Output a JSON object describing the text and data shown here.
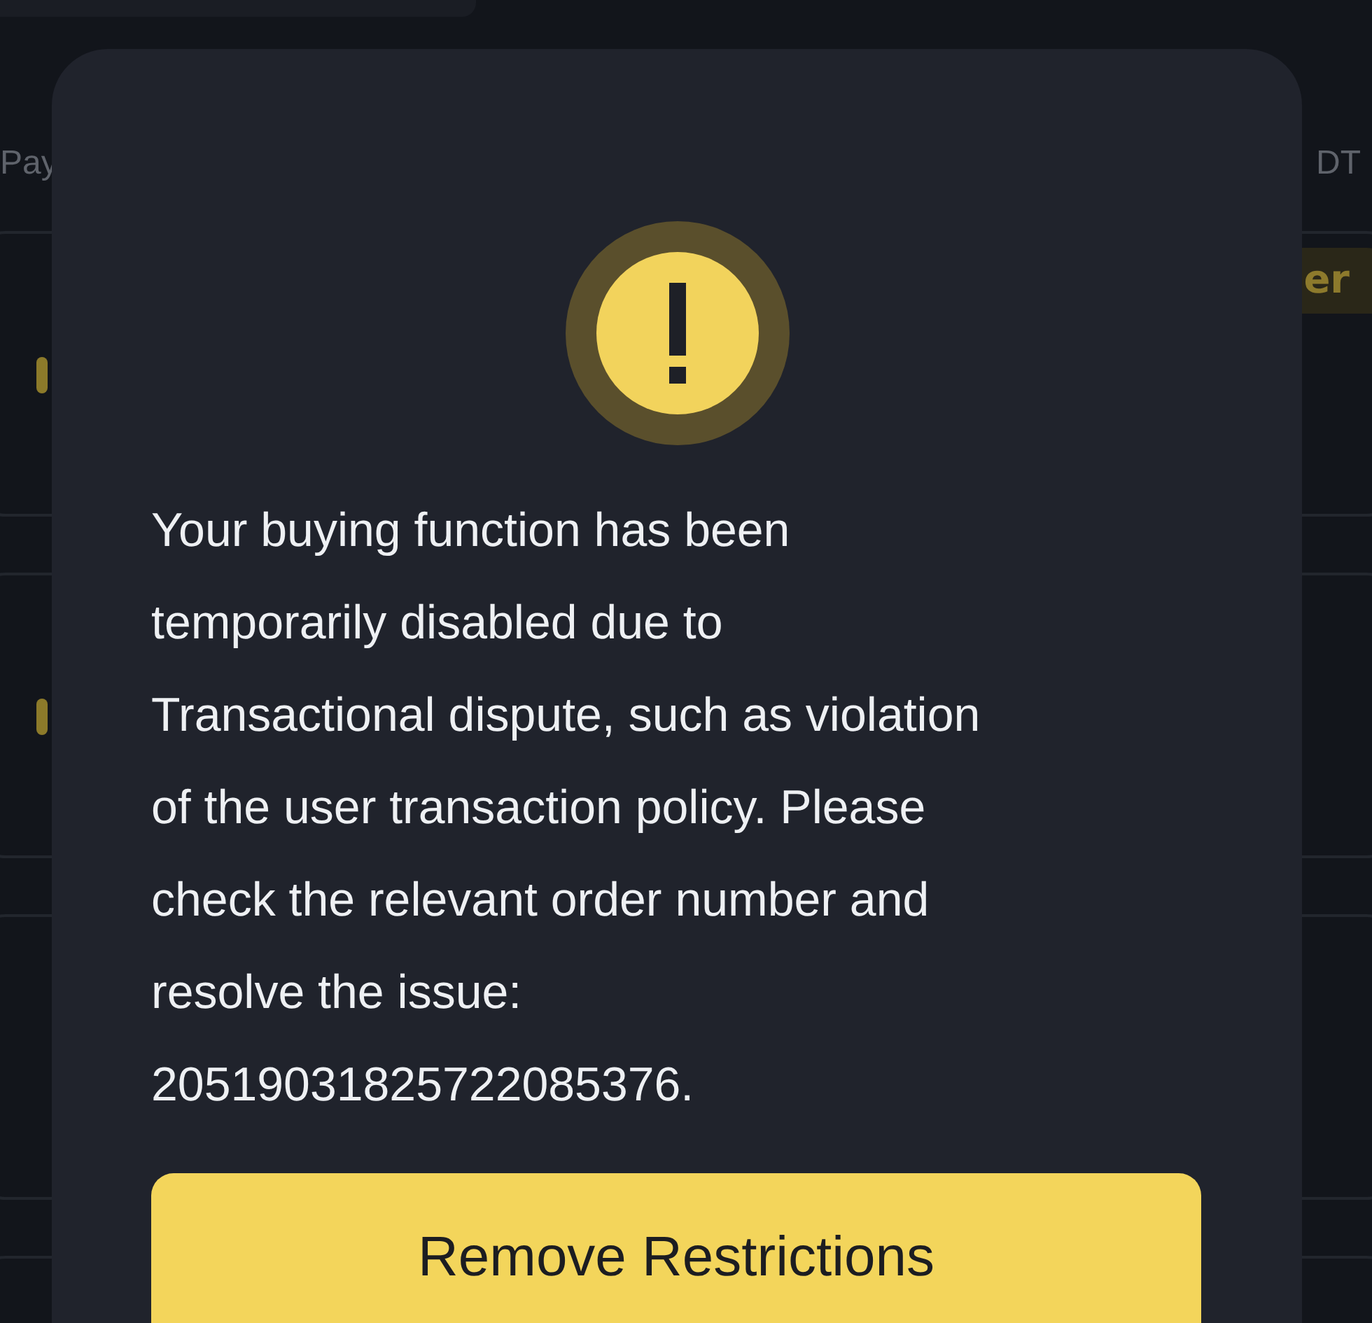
{
  "background": {
    "left_label": "Pay",
    "right_label": "DT",
    "cards": [
      {
        "kind": "tag",
        "tag": "er"
      },
      {
        "kind": "pill"
      },
      {
        "kind": "plain"
      },
      {
        "kind": "plain"
      }
    ]
  },
  "dialog": {
    "message": "Your buying function has been temporarily disabled due to Transactional dispute, such as violation of the user transaction policy. Please check the relevant order number and resolve the issue: 20519031825722085376.",
    "button": "Remove Restrictions"
  }
}
